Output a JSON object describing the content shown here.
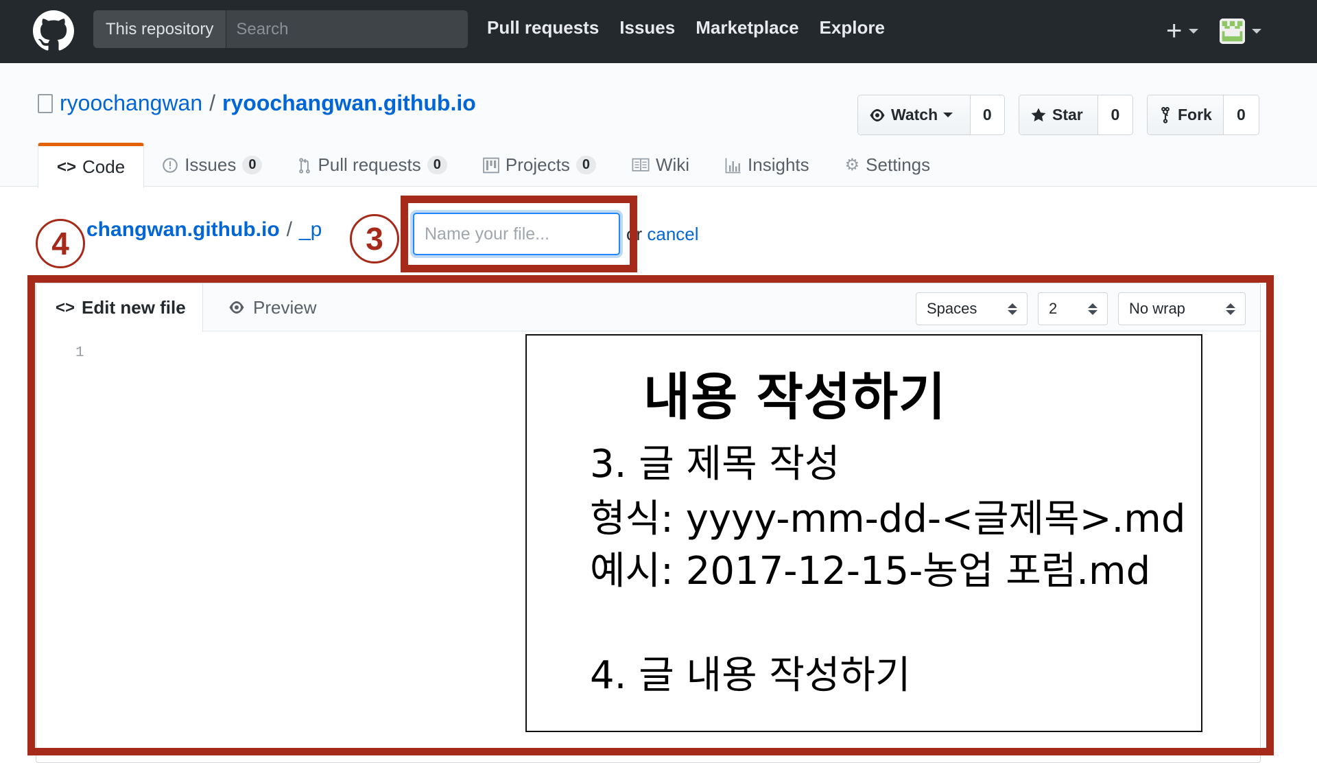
{
  "header": {
    "logo": "github-octocat-icon",
    "search_scope": "This repository",
    "search_placeholder": "Search",
    "nav": [
      "Pull requests",
      "Issues",
      "Marketplace",
      "Explore"
    ],
    "plus_icon": "+",
    "avatar_color": "#8cc665"
  },
  "repo": {
    "owner": "ryoochangwan",
    "separator": "/",
    "name": "ryoochangwan.github.io",
    "actions": [
      {
        "label": "Watch",
        "icon": "eye-icon",
        "count": "0",
        "has_caret": true
      },
      {
        "label": "Star",
        "icon": "star-icon",
        "count": "0"
      },
      {
        "label": "Fork",
        "icon": "fork-icon",
        "count": "0"
      }
    ],
    "tabs": [
      {
        "label": "Code",
        "icon": "code-icon",
        "selected": true
      },
      {
        "label": "Issues",
        "icon": "issue-icon",
        "counter": "0"
      },
      {
        "label": "Pull requests",
        "icon": "pull-request-icon",
        "counter": "0"
      },
      {
        "label": "Projects",
        "icon": "project-icon",
        "counter": "0"
      },
      {
        "label": "Wiki",
        "icon": "book-icon"
      },
      {
        "label": "Insights",
        "icon": "graph-icon"
      },
      {
        "label": "Settings",
        "icon": "gear-icon"
      }
    ],
    "accent_color": "#e36209"
  },
  "breadcrumb": {
    "repo_partial": "changwan.github.io",
    "separator": "/",
    "dir_partial": "_p"
  },
  "filename": {
    "placeholder": "Name your file...",
    "value": "",
    "or_text": "or",
    "cancel_label": "cancel"
  },
  "editor": {
    "tab_edit": "Edit new file",
    "tab_preview": "Preview",
    "indent_mode": "Spaces",
    "indent_size": "2",
    "wrap_mode": "No wrap",
    "line_numbers": [
      "1"
    ]
  },
  "annotations": {
    "color": "#a52a1a",
    "marker_3": "3",
    "marker_4": "4",
    "note": {
      "title": "내용 작성하기",
      "lines": [
        "3. 글 제목 작성",
        "형식: yyyy-mm-dd-<글제목>.md",
        "예시: 2017-12-15-농업 포럼.md",
        "",
        "4. 글 내용 작성하기"
      ]
    }
  }
}
